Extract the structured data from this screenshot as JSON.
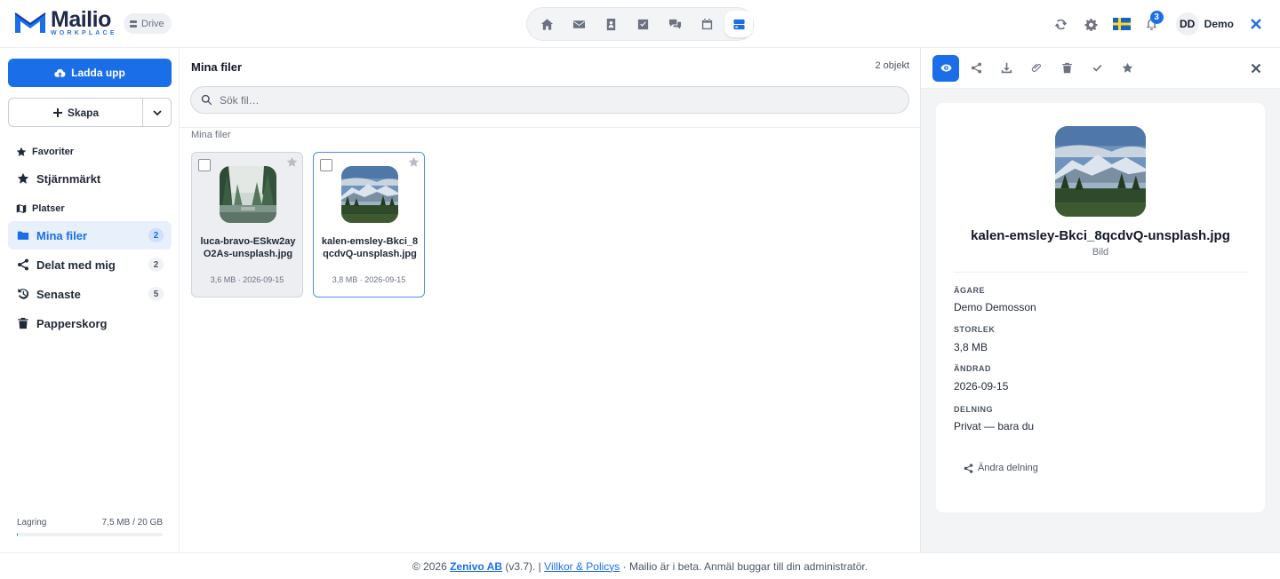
{
  "brand": {
    "name": "Mailio",
    "sub": "WORKPLACE",
    "app_badge": "Drive"
  },
  "appnav": [
    {
      "icon": "home-icon",
      "active": false
    },
    {
      "icon": "mail-icon",
      "active": false
    },
    {
      "icon": "contacts-icon",
      "active": false
    },
    {
      "icon": "tasks-icon",
      "active": false
    },
    {
      "icon": "chat-icon",
      "active": false
    },
    {
      "icon": "calendar-icon",
      "active": false
    },
    {
      "icon": "drive-icon",
      "active": true
    }
  ],
  "topbar": {
    "notification_count": "3",
    "avatar_initials": "DD",
    "user_name": "Demo",
    "accent": "#1a6fe8"
  },
  "sidebar": {
    "upload_label": "Ladda upp",
    "create_label": "Skapa",
    "favorites_label": "Favoriter",
    "starred_label": "Stjärnmärkt",
    "places_label": "Platser",
    "items": [
      {
        "label": "Mina filer",
        "count": "2",
        "icon": "folder-icon",
        "active": true
      },
      {
        "label": "Delat med mig",
        "count": "2",
        "icon": "share-icon",
        "active": false
      },
      {
        "label": "Senaste",
        "count": "5",
        "icon": "history-icon",
        "active": false
      },
      {
        "label": "Papperskorg",
        "count": "",
        "icon": "trash-icon",
        "active": false
      }
    ],
    "storage": {
      "label": "Lagring",
      "value": "7,5 MB / 20 GB",
      "used_fraction": 0.0004
    }
  },
  "main": {
    "title": "Mina filer",
    "object_count": "2 objekt",
    "search_placeholder": "Sök fil…",
    "breadcrumb": "Mina filer",
    "files": [
      {
        "name": "luca-bravo-ESkw2ayO2As-unsplash.jpg",
        "meta": "3,6 MB · 2026-09-15",
        "selected": false
      },
      {
        "name": "kalen-emsley-Bkci_8qcdvQ-unsplash.jpg",
        "meta": "3,8 MB · 2026-09-15",
        "selected": true
      }
    ]
  },
  "panel": {
    "file_name": "kalen-emsley-Bkci_8qcdvQ-unsplash.jpg",
    "file_type": "Bild",
    "owner_label": "ÄGARE",
    "owner_value": "Demo Demosson",
    "size_label": "STORLEK",
    "size_value": "3,8 MB",
    "modified_label": "ÄNDRAD",
    "modified_value": "2026-09-15",
    "sharing_label": "DELNING",
    "sharing_value": "Privat — bara du",
    "change_sharing_label": "Ändra delning"
  },
  "footer": {
    "copyright": "© 2026",
    "company": "Zenivo AB",
    "version": "(v3.7). |",
    "terms": "Villkor & Policys",
    "note": "· Mailio är i beta. Anmäl buggar till din administratör."
  }
}
